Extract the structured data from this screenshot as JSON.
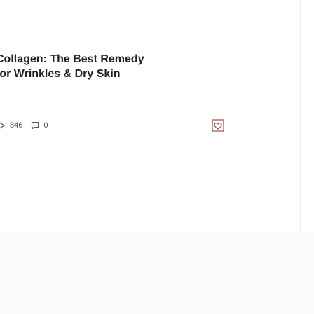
{
  "article": {
    "title_line1": "Collagen: The Best Remedy",
    "title_line2": "for Wrinkles & Dry Skin",
    "views_count": "846",
    "comments_count": "0"
  },
  "icons": {
    "views": "play-icon",
    "comments": "comment-icon",
    "save": "heart-bookmark-icon"
  },
  "colors": {
    "accent": "#a04a4a",
    "text": "#222222",
    "muted": "#555555",
    "band": "#fcfafa"
  }
}
